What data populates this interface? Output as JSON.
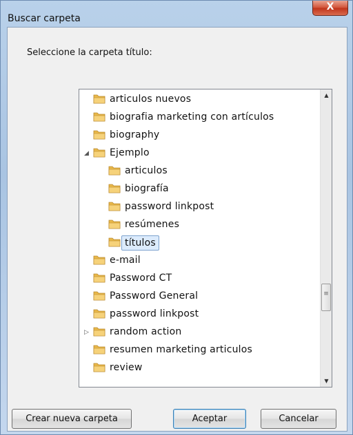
{
  "window": {
    "title": "Buscar carpeta",
    "close_symbol": "X"
  },
  "prompt": "Seleccione la carpeta título:",
  "tree": {
    "items": [
      {
        "label": "articulos nuevos",
        "indent": 0,
        "expander": "",
        "selected": false
      },
      {
        "label": "biografia marketing con artículos",
        "indent": 0,
        "expander": "",
        "selected": false
      },
      {
        "label": "biography",
        "indent": 0,
        "expander": "",
        "selected": false
      },
      {
        "label": "Ejemplo",
        "indent": 0,
        "expander": "◢",
        "selected": false
      },
      {
        "label": "articulos",
        "indent": 1,
        "expander": "",
        "selected": false
      },
      {
        "label": "biografía",
        "indent": 1,
        "expander": "",
        "selected": false
      },
      {
        "label": "password linkpost",
        "indent": 1,
        "expander": "",
        "selected": false
      },
      {
        "label": "resúmenes",
        "indent": 1,
        "expander": "",
        "selected": false
      },
      {
        "label": "títulos",
        "indent": 1,
        "expander": "",
        "selected": true
      },
      {
        "label": "e-mail",
        "indent": 0,
        "expander": "",
        "selected": false
      },
      {
        "label": "Password CT",
        "indent": 0,
        "expander": "",
        "selected": false
      },
      {
        "label": "Password General",
        "indent": 0,
        "expander": "",
        "selected": false
      },
      {
        "label": "password linkpost",
        "indent": 0,
        "expander": "",
        "selected": false
      },
      {
        "label": "random action",
        "indent": 0,
        "expander": "▷",
        "selected": false
      },
      {
        "label": "resumen marketing articulos",
        "indent": 0,
        "expander": "",
        "selected": false
      },
      {
        "label": "review",
        "indent": 0,
        "expander": "",
        "selected": false
      }
    ]
  },
  "scrollbar": {
    "up_symbol": "▲",
    "down_symbol": "▼",
    "grip_symbol": "≡"
  },
  "buttons": {
    "new_folder": "Crear nueva carpeta",
    "ok": "Aceptar",
    "cancel": "Cancelar"
  },
  "colors": {
    "folder": "#e9b84a",
    "selection": "#dcebfc",
    "titlebar": "#b9d1ea"
  }
}
